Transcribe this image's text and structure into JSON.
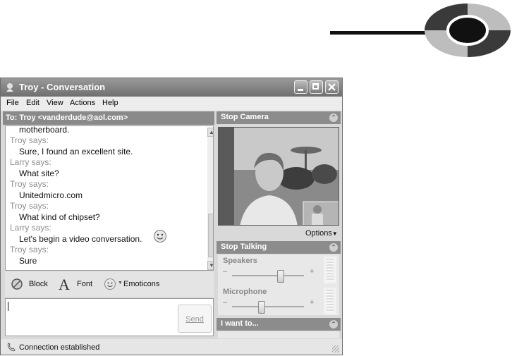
{
  "window": {
    "title": "Troy - Conversation",
    "minimize_icon": "minimize-icon",
    "maximize_icon": "maximize-icon",
    "close_icon": "close-icon"
  },
  "menu": [
    "File",
    "Edit",
    "View",
    "Actions",
    "Help"
  ],
  "to_bar": "To:  Troy <vanderdude@aol.com>",
  "chat": [
    {
      "type": "msg",
      "text": "motherboard."
    },
    {
      "type": "who",
      "text": "Troy says:"
    },
    {
      "type": "msg",
      "text": "Sure, I found an excellent site."
    },
    {
      "type": "who",
      "text": "Larry says:"
    },
    {
      "type": "msg",
      "text": "What site?"
    },
    {
      "type": "who",
      "text": "Troy says:"
    },
    {
      "type": "msg",
      "text": "Unitedmicro.com"
    },
    {
      "type": "who",
      "text": "Troy says:"
    },
    {
      "type": "msg",
      "text": "What kind of chipset?"
    },
    {
      "type": "who",
      "text": "Larry says:"
    },
    {
      "type": "msg",
      "text": "Let's begin a video conversation."
    },
    {
      "type": "who",
      "text": "Troy says:"
    },
    {
      "type": "msg",
      "text": "Sure"
    }
  ],
  "toolbar": {
    "block": "Block",
    "font": "Font",
    "emoticons": "Emoticons"
  },
  "input": {
    "value": "",
    "send": "Send"
  },
  "status": "Connection established",
  "right": {
    "stop_camera": "Stop Camera",
    "options": "Options",
    "stop_talking": "Stop Talking",
    "speakers": "Speakers",
    "microphone": "Microphone",
    "minus": "–",
    "plus": "+",
    "i_want_to": "I want to..."
  },
  "levels": {
    "speakers": 0.7,
    "microphone": 0.4
  }
}
